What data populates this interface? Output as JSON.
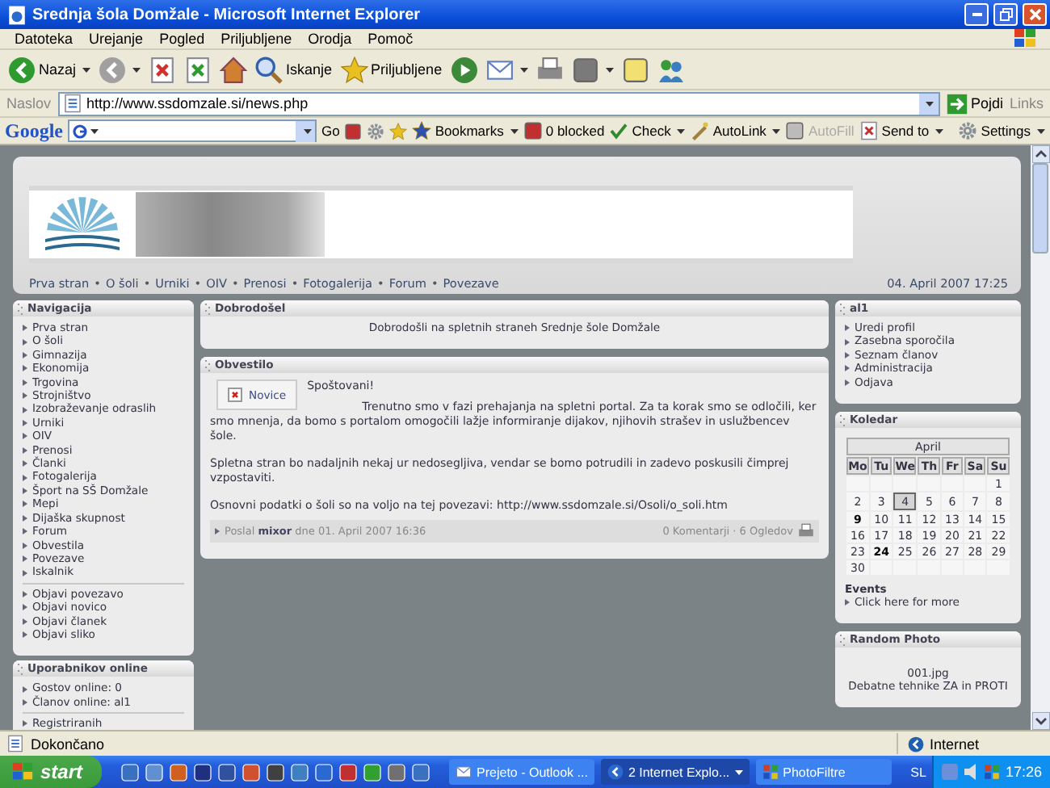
{
  "window": {
    "title": "Srednja šola Domžale - Microsoft Internet Explorer"
  },
  "menu": [
    "Datoteka",
    "Urejanje",
    "Pogled",
    "Priljubljene",
    "Orodja",
    "Pomoč"
  ],
  "toolbar": [
    {
      "kind": "back",
      "label": "Nazaj",
      "dropdown": true
    },
    {
      "kind": "forward",
      "dropdown": true
    },
    {
      "kind": "stop",
      "dropdown": false
    },
    {
      "kind": "refresh",
      "dropdown": false
    },
    {
      "kind": "home",
      "dropdown": false
    },
    {
      "kind": "search",
      "label": "Iskanje",
      "dropdown": false
    },
    {
      "kind": "favorites",
      "label": "Priljubljene",
      "dropdown": false
    },
    {
      "kind": "media",
      "dropdown": false
    },
    {
      "kind": "mail",
      "dropdown": true
    },
    {
      "kind": "print",
      "dropdown": false
    },
    {
      "kind": "edit",
      "dropdown": true
    },
    {
      "kind": "note",
      "dropdown": false
    },
    {
      "kind": "messenger",
      "dropdown": false
    }
  ],
  "address": {
    "label": "Naslov",
    "url": "http://www.ssdomzale.si/news.php",
    "go": "Pojdi",
    "links": "Links"
  },
  "google_bar": {
    "logo": "Google",
    "go": "Go",
    "items": [
      {
        "kind": "bookmarks",
        "label": "Bookmarks",
        "dropdown": true,
        "disabled": false
      },
      {
        "kind": "blocked",
        "label": "0 blocked",
        "dropdown": false,
        "disabled": false
      },
      {
        "kind": "check",
        "label": "Check",
        "dropdown": true,
        "disabled": false
      },
      {
        "kind": "autolink",
        "label": "AutoLink",
        "dropdown": true,
        "disabled": false
      },
      {
        "kind": "autofill",
        "label": "AutoFill",
        "dropdown": false,
        "disabled": true
      },
      {
        "kind": "sendto",
        "label": "Send to",
        "dropdown": true,
        "disabled": false
      }
    ],
    "settings": "Settings"
  },
  "header": {
    "separator": "•",
    "nav_links": [
      "Prva stran",
      "O šoli",
      "Urniki",
      "OIV",
      "Prenosi",
      "Fotogalerija",
      "Forum",
      "Povezave"
    ],
    "date": "04. April 2007 17:25"
  },
  "left_panels": [
    {
      "title": "Navigacija",
      "groups": [
        [
          "Prva stran",
          "O šoli",
          "Gimnazija",
          "Ekonomija",
          "Trgovina",
          "Strojništvo",
          "Izobraževanje odraslih",
          "Urniki",
          "OIV",
          "Prenosi",
          "Članki",
          "Fotogalerija",
          "Šport na SŠ Domžale",
          "Mepi",
          "Dijaška skupnost",
          "Forum",
          "Obvestila",
          "Povezave",
          "Iskalnik"
        ],
        [
          "Objavi povezavo",
          "Objavi novico",
          "Objavi članek",
          "Objavi sliko"
        ]
      ]
    },
    {
      "title": "Uporabnikov online",
      "groups": [
        [
          "Gostov online: 0",
          "Članov online: al1"
        ],
        [
          "Registriranih"
        ]
      ]
    }
  ],
  "welcome": {
    "title": "Dobrodošel",
    "text": "Dobrodošli na spletnih straneh Srednje šole Domžale"
  },
  "news": {
    "title": "Obvestilo",
    "category": "Novice",
    "greeting": "Spoštovani!",
    "paragraphs": [
      "Trenutno smo v fazi prehajanja na spletni portal. Za ta korak smo se odločili, ker smo mnenja, da bomo s portalom omogočili lažje informiranje dijakov, njihovih strašev in uslužbencev šole.",
      "Spletna stran bo nadaljnih nekaj ur nedosegljiva, vendar se bomo potrudili in zadevo poskusili čimprej vzpostaviti."
    ],
    "link_intro": "Osnovni podatki o šoli so na voljo na tej povezavi:",
    "link": "http://www.ssdomzale.si/Osoli/o_soli.htm",
    "posted": "Poslal **mixor** dne 01. April 2007 16:36",
    "stats": "0 Komentarji · 6 Ogledov"
  },
  "user_panel": {
    "title": "al1",
    "items": [
      "Uredi profil",
      "Zasebna sporočila",
      "Seznam članov",
      "Administracija",
      "Odjava"
    ]
  },
  "calendar": {
    "title": "Koledar",
    "month": "April",
    "weekdays": [
      "Mo",
      "Tu",
      "We",
      "Th",
      "Fr",
      "Sa",
      "Su"
    ],
    "weeks": [
      [
        {
          "kind": "blank"
        },
        {
          "kind": "blank"
        },
        {
          "kind": "blank"
        },
        {
          "kind": "blank"
        },
        {
          "kind": "blank"
        },
        {
          "kind": "blank"
        },
        {
          "kind": "day",
          "day": "1",
          "today": false,
          "event": false
        }
      ],
      [
        {
          "day": "2",
          "today": false,
          "event": false
        },
        {
          "day": "3",
          "today": false,
          "event": false
        },
        {
          "day": "4",
          "today": true,
          "event": false
        },
        {
          "day": "5",
          "today": false,
          "event": false
        },
        {
          "day": "6",
          "today": false,
          "event": false
        },
        {
          "day": "7",
          "today": false,
          "event": false
        },
        {
          "day": "8",
          "today": false,
          "event": false
        }
      ],
      [
        {
          "day": "9",
          "today": false,
          "event": true
        },
        {
          "day": "10",
          "today": false,
          "event": false
        },
        {
          "day": "11",
          "today": false,
          "event": false
        },
        {
          "day": "12",
          "today": false,
          "event": false
        },
        {
          "day": "13",
          "today": false,
          "event": false
        },
        {
          "day": "14",
          "today": false,
          "event": false
        },
        {
          "day": "15",
          "today": false,
          "event": false
        }
      ],
      [
        {
          "day": "16",
          "today": false,
          "event": false
        },
        {
          "day": "17",
          "today": false,
          "event": false
        },
        {
          "day": "18",
          "today": false,
          "event": false
        },
        {
          "day": "19",
          "today": false,
          "event": false
        },
        {
          "day": "20",
          "today": false,
          "event": false
        },
        {
          "day": "21",
          "today": false,
          "event": false
        },
        {
          "day": "22",
          "today": false,
          "event": false
        }
      ],
      [
        {
          "day": "23",
          "today": false,
          "event": false
        },
        {
          "day": "24",
          "today": false,
          "event": true
        },
        {
          "day": "25",
          "today": false,
          "event": false
        },
        {
          "day": "26",
          "today": false,
          "event": false
        },
        {
          "day": "27",
          "today": false,
          "event": false
        },
        {
          "day": "28",
          "today": false,
          "event": false
        },
        {
          "day": "29",
          "today": false,
          "event": false
        }
      ],
      [
        {
          "kind": "day",
          "day": "30",
          "today": false,
          "event": false
        },
        {
          "kind": "blank"
        },
        {
          "kind": "blank"
        },
        {
          "kind": "blank"
        },
        {
          "kind": "blank"
        },
        {
          "kind": "blank"
        },
        {
          "kind": "blank"
        }
      ]
    ],
    "events_title": "Events",
    "events_link": "Click here for more"
  },
  "random_photo": {
    "title": "Random Photo",
    "file": "001.jpg",
    "caption": "Debatne tehnike ZA in PROTI"
  },
  "status_bar": {
    "text": "Dokončano",
    "zone": "Internet"
  },
  "taskbar": {
    "start": "start",
    "tasks": [
      {
        "label": "Prejeto - Outlook ...",
        "kind": "mail",
        "selected": false,
        "dropdown": false
      },
      {
        "label": "2 Internet Explo...",
        "kind": "browser",
        "selected": true,
        "dropdown": true
      },
      {
        "label": "PhotoFiltre",
        "kind": "paint",
        "selected": false,
        "dropdown": false
      }
    ],
    "language": "SL",
    "clock": "17:26"
  }
}
